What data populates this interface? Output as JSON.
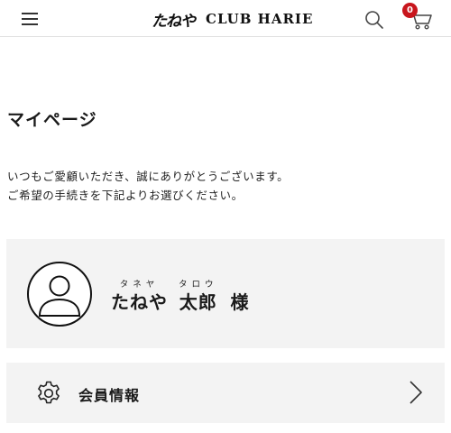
{
  "header": {
    "logo_jp": "たねや",
    "logo_en": "CLUB HARIE",
    "cart_count": "0",
    "icons": [
      "menu-icon",
      "search-icon",
      "cart-icon"
    ]
  },
  "page": {
    "title": "マイページ",
    "greeting_line1": "いつもご愛顧いただき、誠にありがとうございます。",
    "greeting_line2": "ご希望の手続きを下記よりお選びください。"
  },
  "user": {
    "family_name": "たねや",
    "family_name_kana": "タネヤ",
    "given_name": "太郎",
    "given_name_kana": "タロウ",
    "honorific": "様",
    "icon": "user-avatar-icon"
  },
  "menu": {
    "member_info_label": "会員情報",
    "member_info_icon": "gear-icon",
    "arrow_icon": "chevron-right-icon"
  },
  "colors": {
    "badge": "#c8161d",
    "card_background": "#f3f3f3",
    "text": "#1a1a1a"
  }
}
